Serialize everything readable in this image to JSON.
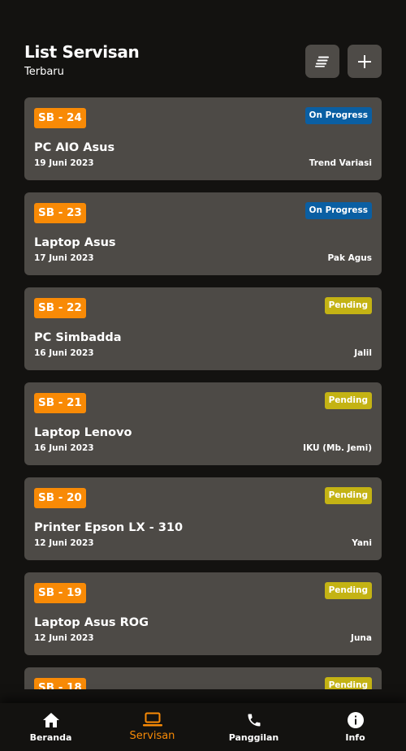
{
  "header": {
    "title": "List Servisan",
    "subtitle": "Terbaru",
    "sort_icon": "sort-lines-icon",
    "add_icon": "plus-icon"
  },
  "colors": {
    "background": "#131210",
    "card": "#4d4a46",
    "accent": "#f88a06",
    "on_progress": "#0a5fa3",
    "pending": "#c4b314"
  },
  "services": [
    {
      "code": "SB - 24",
      "status": "On Progress",
      "status_type": "progress",
      "name": "PC AIO Asus",
      "date": "19 Juni 2023",
      "customer": "Trend Variasi"
    },
    {
      "code": "SB - 23",
      "status": "On Progress",
      "status_type": "progress",
      "name": "Laptop Asus",
      "date": "17 Juni 2023",
      "customer": "Pak Agus"
    },
    {
      "code": "SB - 22",
      "status": "Pending",
      "status_type": "pending",
      "name": "PC Simbadda",
      "date": "16 Juni 2023",
      "customer": "Jalil"
    },
    {
      "code": "SB - 21",
      "status": "Pending",
      "status_type": "pending",
      "name": "Laptop Lenovo",
      "date": "16 Juni 2023",
      "customer": "IKU (Mb. Jemi)"
    },
    {
      "code": "SB - 20",
      "status": "Pending",
      "status_type": "pending",
      "name": "Printer Epson LX - 310",
      "date": "12 Juni 2023",
      "customer": "Yani"
    },
    {
      "code": "SB - 19",
      "status": "Pending",
      "status_type": "pending",
      "name": "Laptop Asus ROG",
      "date": "12 Juni 2023",
      "customer": "Juna"
    },
    {
      "code": "SB - 18",
      "status": "Pending",
      "status_type": "pending",
      "name": "",
      "date": "",
      "customer": ""
    }
  ],
  "nav": [
    {
      "label": "Beranda",
      "icon": "home-icon",
      "active": false
    },
    {
      "label": "Servisan",
      "icon": "laptop-icon",
      "active": true
    },
    {
      "label": "Panggilan",
      "icon": "phone-icon",
      "active": false
    },
    {
      "label": "Info",
      "icon": "info-icon",
      "active": false
    }
  ]
}
